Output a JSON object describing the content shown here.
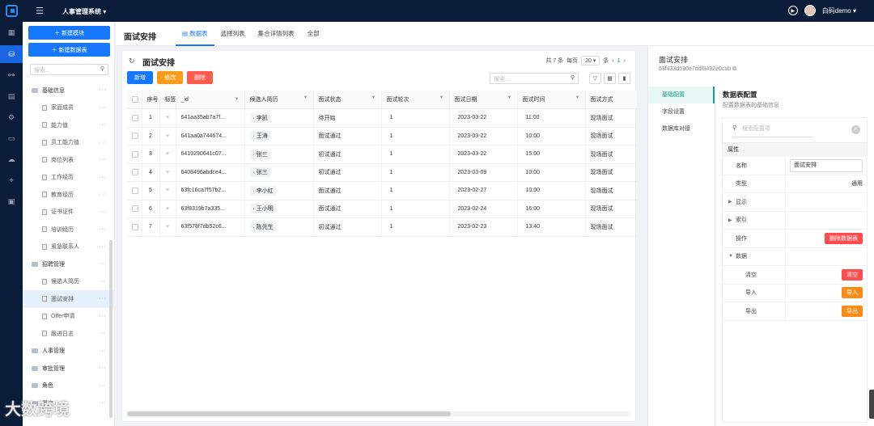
{
  "topbar": {
    "app_name": "人事管理系统 ▾",
    "username": "白码demo ▾"
  },
  "sidebar": {
    "new_module": "＋ 新建模块",
    "new_table": "＋ 新建数据表",
    "search_placeholder": "搜索...",
    "tree": [
      {
        "label": "基础信息",
        "level": 1
      },
      {
        "label": "家庭成员",
        "level": 2
      },
      {
        "label": "能力值",
        "level": 2
      },
      {
        "label": "员工能力值",
        "level": 2
      },
      {
        "label": "岗位列表",
        "level": 2
      },
      {
        "label": "工作经历",
        "level": 2
      },
      {
        "label": "教育经历",
        "level": 2
      },
      {
        "label": "证书证件",
        "level": 2
      },
      {
        "label": "培训经历",
        "level": 2
      },
      {
        "label": "紧急联系人",
        "level": 2
      },
      {
        "label": "招聘管理",
        "level": 1
      },
      {
        "label": "候选人简历",
        "level": 2
      },
      {
        "label": "面试安排",
        "level": 2,
        "active": true
      },
      {
        "label": "Offer申请",
        "level": 2
      },
      {
        "label": "跟进日志",
        "level": 2
      },
      {
        "label": "人事管理",
        "level": 1
      },
      {
        "label": "审批管理",
        "level": 1
      },
      {
        "label": "角色",
        "level": 1
      },
      {
        "label": "用户",
        "level": 1
      }
    ]
  },
  "main": {
    "title": "面试安排",
    "tabs": [
      "▤ 数据表",
      "选择列表",
      "集合详情列表",
      "全部"
    ]
  },
  "panel": {
    "title": "面试安排",
    "total": "共 7 条",
    "per_page_label": "每页",
    "page_size": "20 ▾",
    "unit": "条",
    "page": "1",
    "buttons": {
      "add": "新增",
      "edit": "修改",
      "delete": "删除"
    },
    "search_placeholder": "搜索...",
    "columns": [
      "序号",
      "标签",
      "_id",
      "候选人简历",
      "面试状态",
      "面试轮次",
      "面试日期",
      "面试时间",
      "面试方式"
    ],
    "rows": [
      {
        "no": "1",
        "id": "641aa35ab7a7f...",
        "candidate": "· 李凯",
        "status": "待开始",
        "round": "1",
        "date": "2023-03-22",
        "time": "11:00",
        "mode": "现场面试"
      },
      {
        "no": "2",
        "id": "641aa0a744674...",
        "candidate": "· 王涛",
        "status": "面试通过",
        "round": "1",
        "date": "2023-03-22",
        "time": "10:00",
        "mode": "现场面试"
      },
      {
        "no": "3",
        "id": "6419290641c07...",
        "candidate": "· 张三",
        "status": "初试通过",
        "round": "1",
        "date": "2023-03-22",
        "time": "15:00",
        "mode": "现场面试"
      },
      {
        "no": "4",
        "id": "6408496abdce4...",
        "candidate": "· 张三",
        "status": "初试通过",
        "round": "1",
        "date": "2023-03-09",
        "time": "10:00",
        "mode": "现场面试"
      },
      {
        "no": "5",
        "id": "63fc16ca7f57b2...",
        "candidate": "· 李小红",
        "status": "面试通过",
        "round": "1",
        "date": "2023-02-27",
        "time": "10:00",
        "mode": "现场面试"
      },
      {
        "no": "6",
        "id": "63f8319b7a335...",
        "candidate": "· 王小明",
        "status": "面试通过",
        "round": "1",
        "date": "2023-02-24",
        "time": "16:00",
        "mode": "现场面试"
      },
      {
        "no": "7",
        "id": "63f578f7db52c6...",
        "candidate": "· 陈先生",
        "status": "初试通过",
        "round": "1",
        "date": "2023-02-23",
        "time": "13:40",
        "mode": "现场面试"
      }
    ]
  },
  "right": {
    "title": "面试安排",
    "id": "63f433d590e7ddf9492e0cab ⧉",
    "nav": [
      "基础配置",
      "字段设置",
      "数据库对接"
    ],
    "cfg_title": "数据表配置",
    "cfg_sub": "配置数据表的基础信息",
    "search_placeholder": "搜索配置项",
    "prop_header": "属性",
    "props": [
      {
        "key": "名称",
        "value": "面试安排",
        "type": "input"
      },
      {
        "key": "类型",
        "value": "通用",
        "type": "text"
      },
      {
        "key": "显示",
        "type": "expand"
      },
      {
        "key": "索引",
        "type": "expand"
      },
      {
        "key": "操作",
        "value": "删除数据表",
        "type": "red"
      },
      {
        "key": "数据",
        "type": "open"
      },
      {
        "key": "清空",
        "value": "清空",
        "type": "red",
        "sub": true
      },
      {
        "key": "导入",
        "value": "导入",
        "type": "orange",
        "sub": true
      },
      {
        "key": "导出",
        "value": "导出",
        "type": "orange",
        "sub": true
      }
    ]
  },
  "watermark": "大数跨境",
  "colors": {
    "primary": "#1677ff",
    "nav_dark": "#0b1c38",
    "warning": "#fa9c1b",
    "danger": "#ff4d4f",
    "teal": "#1a9e8a"
  }
}
